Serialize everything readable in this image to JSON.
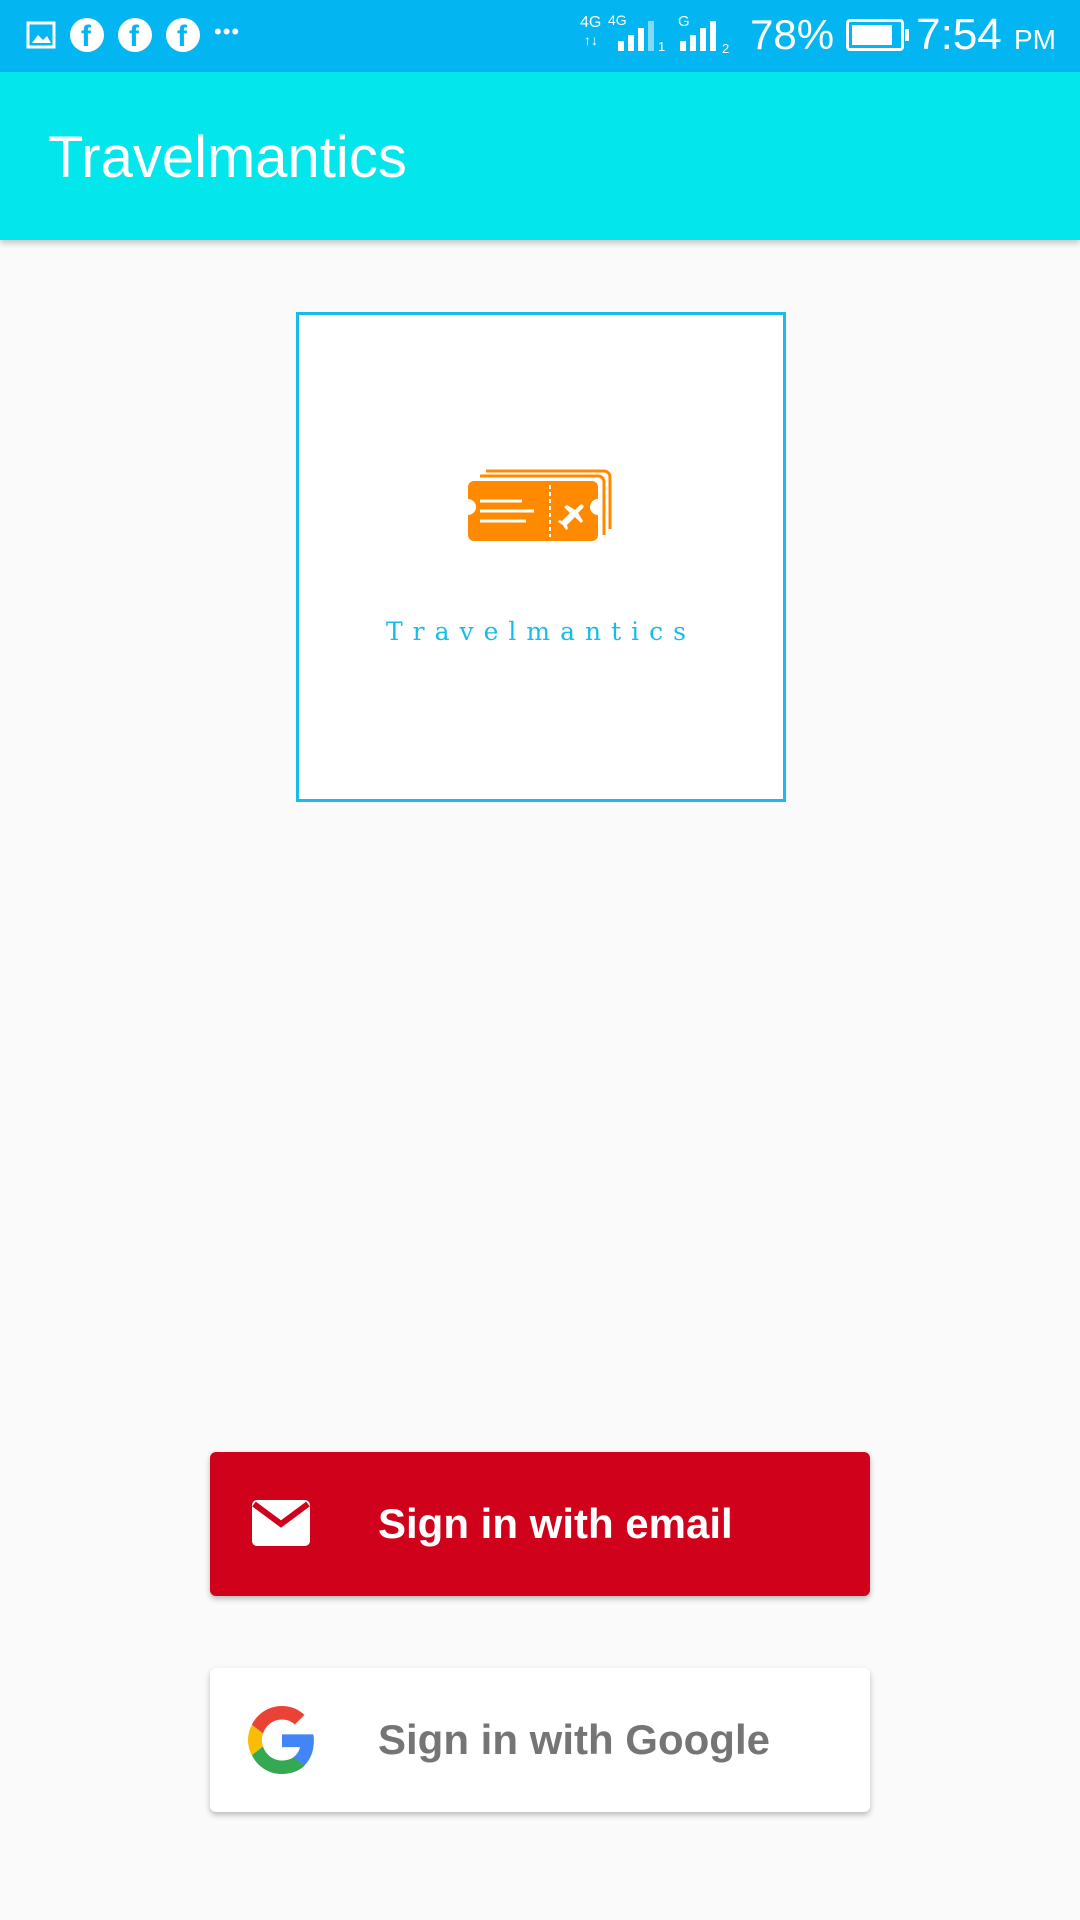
{
  "status_bar": {
    "notification_icons": [
      "image-icon",
      "facebook-icon",
      "facebook-icon",
      "facebook-icon",
      "more-dots-icon"
    ],
    "network_1": "4G",
    "network_2": "4G",
    "sim1_label": "1",
    "network_3": "G",
    "sim2_label": "2",
    "battery": "78%",
    "time": "7:54",
    "ampm": "PM"
  },
  "app_bar": {
    "title": "Travelmantics"
  },
  "logo": {
    "wordmark": "Travelmantics",
    "icon": "plane-ticket-icon"
  },
  "buttons": {
    "email": {
      "label": "Sign in with email",
      "icon": "mail-icon"
    },
    "google": {
      "label": "Sign in with Google",
      "icon": "google-icon"
    }
  },
  "colors": {
    "status_bar": "#03b5f0",
    "app_bar": "#03e6ec",
    "email_button": "#d0021b",
    "logo_orange": "#ff8a00",
    "logo_blue": "#17bde9"
  }
}
